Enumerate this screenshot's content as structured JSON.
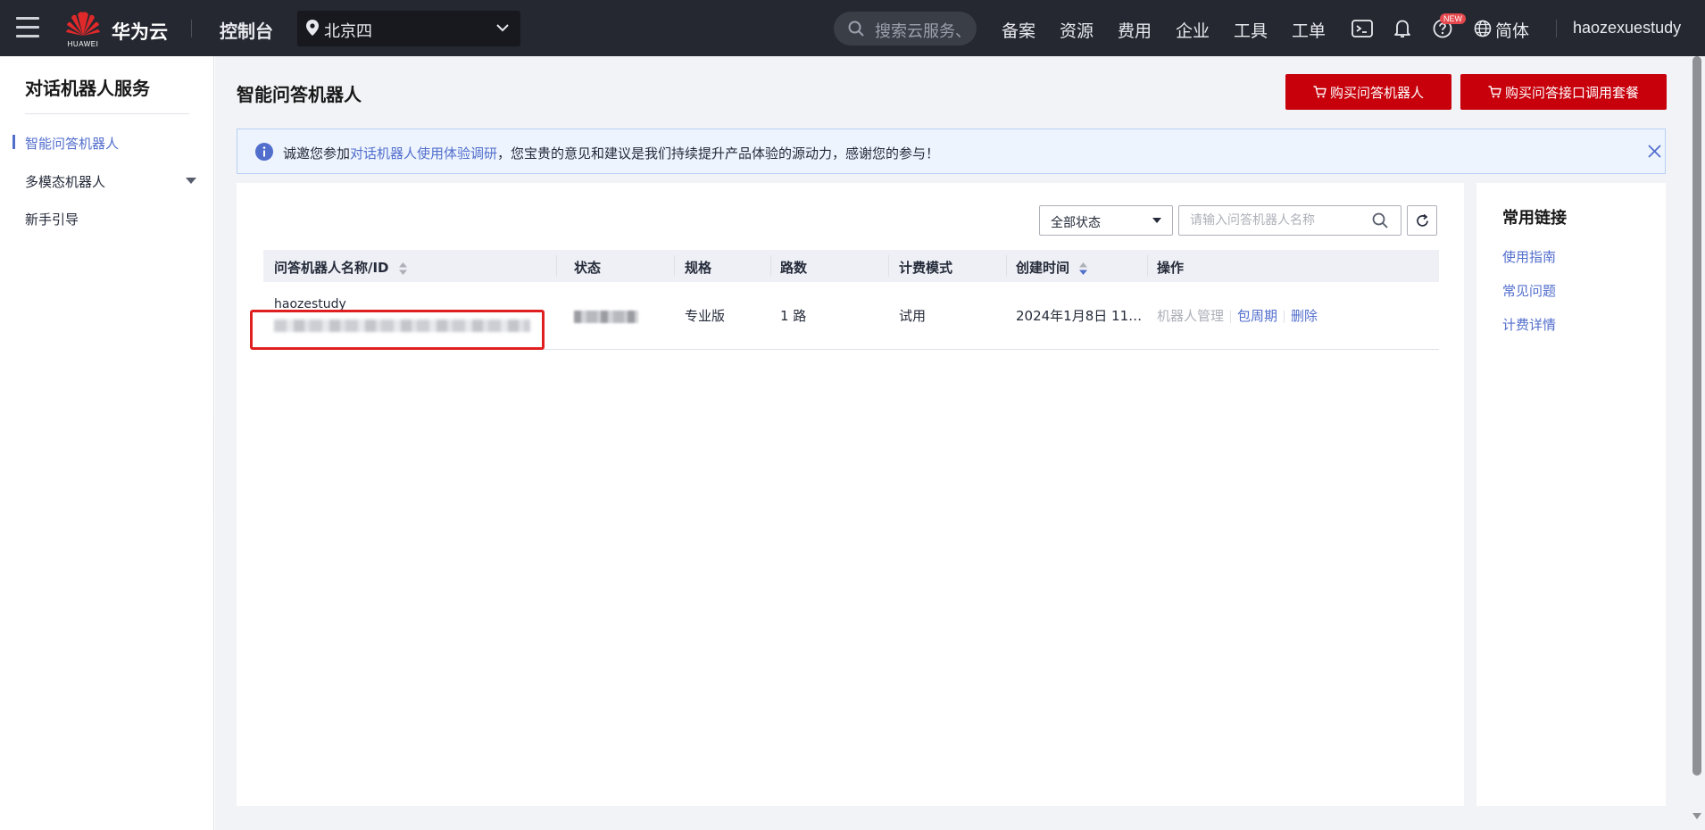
{
  "topbar": {
    "brand": "华为云",
    "logo_text": "HUAWEI",
    "console": "控制台",
    "region": "北京四",
    "search_placeholder": "搜索云服务、",
    "nav": [
      "备案",
      "资源",
      "费用",
      "企业",
      "工具",
      "工单"
    ],
    "badge": "NEW",
    "language": "简体",
    "username": "haozexuestudy"
  },
  "sidebar": {
    "title": "对话机器人服务",
    "items": [
      {
        "label": "智能问答机器人"
      },
      {
        "label": "多模态机器人"
      },
      {
        "label": "新手引导"
      }
    ]
  },
  "main": {
    "title": "智能问答机器人",
    "buttons": {
      "buy_robot": "购买问答机器人",
      "buy_package": "购买问答接口调用套餐"
    },
    "notice": {
      "prefix": "诚邀您参加",
      "link": "对话机器人使用体验调研",
      "suffix": "，您宝贵的意见和建议是我们持续提升产品体验的源动力，感谢您的参与！"
    },
    "filter": {
      "status_value": "全部状态",
      "search_placeholder": "请输入问答机器人名称"
    },
    "table": {
      "headers": [
        "问答机器人名称/ID",
        "状态",
        "规格",
        "路数",
        "计费模式",
        "创建时间",
        "操作"
      ],
      "rows": [
        {
          "name": "haozestudy",
          "spec": "专业版",
          "lines": "1 路",
          "billing": "试用",
          "created": "2024年1月8日 11…",
          "ops": [
            "机器人管理",
            "包周期",
            "删除"
          ]
        }
      ]
    },
    "links": {
      "title": "常用链接",
      "items": [
        "使用指南",
        "常见问题",
        "计费详情"
      ]
    }
  },
  "colors": {
    "topbar": "#252830",
    "accent": "#526ecc",
    "primary_red": "#c7000b",
    "highlight_box": "#e02020"
  }
}
